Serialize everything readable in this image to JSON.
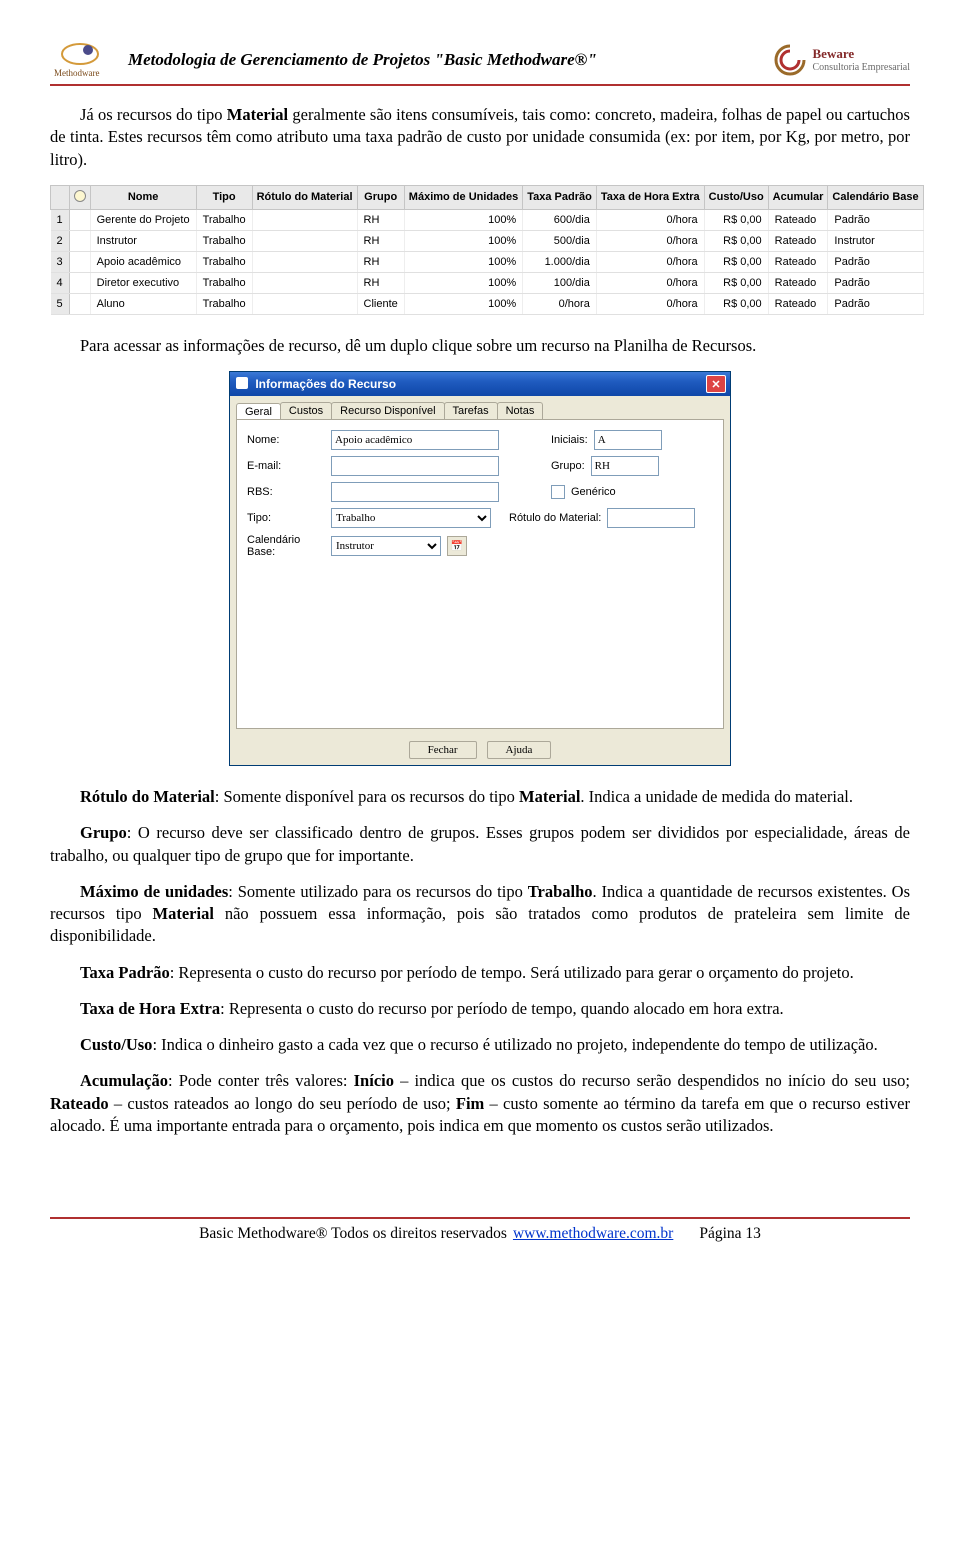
{
  "header": {
    "title": "Metodologia de Gerenciamento de Projetos \"Basic Methodware®\"",
    "logo_left_label": "Methodware",
    "logo_right_line1": "Beware",
    "logo_right_line2": "Consultoria Empresarial"
  },
  "paragraphs": {
    "p1a": "Já os recursos do tipo ",
    "p1b": "Material",
    "p1c": " geralmente são itens consumíveis, tais como: concreto, madeira, folhas de papel ou cartuchos de tinta. Estes recursos têm como atributo uma taxa padrão de custo por unidade consumida (ex: por item, por Kg, por metro, por litro).",
    "p2": "Para acessar as informações de recurso, dê um duplo clique sobre um recurso na Planilha de Recursos.",
    "p3a": "Rótulo do Material",
    "p3b": ": Somente disponível para os recursos do tipo ",
    "p3c": "Material",
    "p3d": ". Indica a unidade de medida do material.",
    "p4a": "Grupo",
    "p4b": ": O recurso deve ser classificado dentro de grupos. Esses grupos podem ser divididos por especialidade, áreas de trabalho, ou qualquer tipo de grupo que for importante.",
    "p5a": "Máximo de unidades",
    "p5b": ": Somente utilizado para os recursos do tipo ",
    "p5c": "Trabalho",
    "p5d": ". Indica a quantidade de recursos existentes. Os recursos tipo ",
    "p5e": "Material",
    "p5f": " não possuem essa informação, pois são tratados como produtos de prateleira sem limite de disponibilidade.",
    "p6a": "Taxa Padrão",
    "p6b": ": Representa o custo do recurso por período de tempo. Será utilizado para gerar o orçamento do projeto.",
    "p7a": "Taxa de Hora Extra",
    "p7b": ": Representa o custo do recurso por período de tempo, quando alocado em hora extra.",
    "p8a": "Custo/Uso",
    "p8b": ": Indica o dinheiro gasto a cada vez que o recurso é utilizado no projeto, independente do tempo de utilização.",
    "p9a": "Acumulação",
    "p9b": ": Pode conter três valores: ",
    "p9c": "Início",
    "p9d": " – indica que os custos do recurso serão despendidos no início do seu uso; ",
    "p9e": "Rateado",
    "p9f": " – custos rateados ao longo do seu período de uso; ",
    "p9g": "Fim",
    "p9h": " – custo somente ao término da tarefa em que o recurso estiver alocado. É uma importante entrada para o orçamento, pois indica em que momento os custos serão utilizados."
  },
  "table": {
    "headers": [
      "Nome",
      "Tipo",
      "Rótulo do Material",
      "Grupo",
      "Máximo de Unidades",
      "Taxa Padrão",
      "Taxa de Hora Extra",
      "Custo/Uso",
      "Acumular",
      "Calendário Base"
    ],
    "rows": [
      {
        "n": "1",
        "nome": "Gerente do Projeto",
        "tipo": "Trabalho",
        "rotulo": "",
        "grupo": "RH",
        "max": "100%",
        "taxa": "600/dia",
        "extra": "0/hora",
        "custo": "R$ 0,00",
        "acum": "Rateado",
        "cal": "Padrão"
      },
      {
        "n": "2",
        "nome": "Instrutor",
        "tipo": "Trabalho",
        "rotulo": "",
        "grupo": "RH",
        "max": "100%",
        "taxa": "500/dia",
        "extra": "0/hora",
        "custo": "R$ 0,00",
        "acum": "Rateado",
        "cal": "Instrutor"
      },
      {
        "n": "3",
        "nome": "Apoio acadêmico",
        "tipo": "Trabalho",
        "rotulo": "",
        "grupo": "RH",
        "max": "100%",
        "taxa": "1.000/dia",
        "extra": "0/hora",
        "custo": "R$ 0,00",
        "acum": "Rateado",
        "cal": "Padrão"
      },
      {
        "n": "4",
        "nome": "Diretor executivo",
        "tipo": "Trabalho",
        "rotulo": "",
        "grupo": "RH",
        "max": "100%",
        "taxa": "100/dia",
        "extra": "0/hora",
        "custo": "R$ 0,00",
        "acum": "Rateado",
        "cal": "Padrão"
      },
      {
        "n": "5",
        "nome": "Aluno",
        "tipo": "Trabalho",
        "rotulo": "",
        "grupo": "Cliente",
        "max": "100%",
        "taxa": "0/hora",
        "extra": "0/hora",
        "custo": "R$ 0,00",
        "acum": "Rateado",
        "cal": "Padrão"
      }
    ]
  },
  "dialog": {
    "title": "Informações do Recurso",
    "tabs": [
      "Geral",
      "Custos",
      "Recurso Disponível",
      "Tarefas",
      "Notas"
    ],
    "fields": {
      "nome_label": "Nome:",
      "nome_val": "Apoio acadêmico",
      "iniciais_label": "Iniciais:",
      "iniciais_val": "A",
      "email_label": "E-mail:",
      "email_val": "",
      "grupo_label": "Grupo:",
      "grupo_val": "RH",
      "rbs_label": "RBS:",
      "rbs_val": "",
      "generico_label": "Genérico",
      "tipo_label": "Tipo:",
      "tipo_val": "Trabalho",
      "rotulo_label": "Rótulo do Material:",
      "rotulo_val": "",
      "calbase_label": "Calendário Base:",
      "calbase_val": "Instrutor"
    },
    "btn_fechar": "Fechar",
    "btn_ajuda": "Ajuda"
  },
  "footer": {
    "text_left": "Basic Methodware® Todos os direitos reservados",
    "link": "www.methodware.com.br",
    "page": "Página 13"
  }
}
